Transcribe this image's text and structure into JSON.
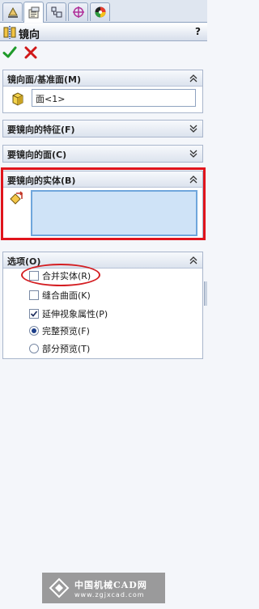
{
  "tabs": [
    {
      "icon": "feature-manager-icon"
    },
    {
      "icon": "property-manager-icon",
      "active": true
    },
    {
      "icon": "configuration-manager-icon"
    },
    {
      "icon": "dimxpert-icon"
    },
    {
      "icon": "display-manager-icon"
    }
  ],
  "title": "镜向",
  "help_label": "?",
  "groups": {
    "mirror_plane": {
      "title": "镜向面/基准面(M)",
      "value": "面<1>",
      "state": "expanded"
    },
    "features": {
      "title": "要镜向的特征(F)",
      "state": "collapsed"
    },
    "faces": {
      "title": "要镜向的面(C)",
      "state": "collapsed"
    },
    "bodies": {
      "title": "要镜向的实体(B)",
      "state": "expanded",
      "value": ""
    },
    "options": {
      "title": "选项(O)",
      "state": "expanded",
      "merge_solids": {
        "label": "合并实体(R)",
        "checked": false
      },
      "knit_surfaces": {
        "label": "缝合曲面(K)",
        "checked": false
      },
      "propagate_visual": {
        "label": "延伸视象属性(P)",
        "checked": true
      },
      "full_preview": {
        "label": "完整预览(F)",
        "selected": true
      },
      "partial_preview": {
        "label": "部分预览(T)",
        "selected": false
      }
    }
  },
  "watermark": {
    "title": "中国机械CAD网",
    "url": "www.zgjxcad.com"
  },
  "colors": {
    "accent_red": "#e0141c",
    "ok_green": "#1f9a2a",
    "cancel_red": "#d01818",
    "active_field": "#cfe3f7"
  }
}
